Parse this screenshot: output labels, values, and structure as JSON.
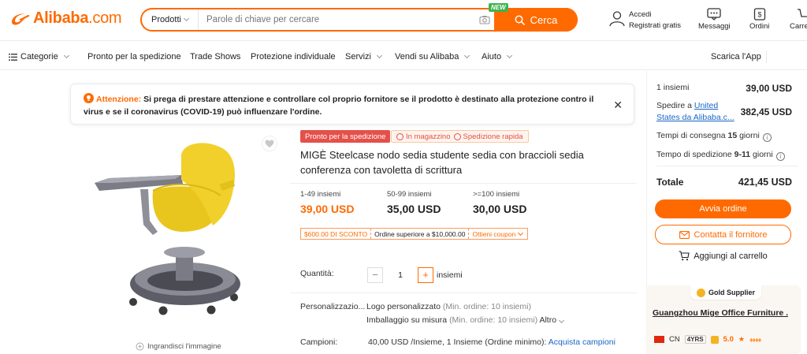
{
  "header": {
    "logo_text": "Alibaba",
    "logo_suffix": ".com",
    "search_category": "Prodotti",
    "search_placeholder": "Parole di chiave per cercare",
    "new_badge": "NEW",
    "search_button": "Cerca",
    "signin_label": "Accedi",
    "register_label": "Registrati gratis",
    "messages_label": "Messaggi",
    "orders_label": "Ordini",
    "cart_label": "Carrello"
  },
  "nav": {
    "categories": "Categorie",
    "items": [
      "Pronto per la spedizione",
      "Trade Shows",
      "Protezione individuale",
      "Servizi",
      "Vendi su Alibaba",
      "Aiuto"
    ],
    "app": "Scarica l'App"
  },
  "alert": {
    "label": "Attenzione:",
    "text": "Si prega di prestare attenzione e controllare col proprio fornitore se il prodotto è destinato alla protezione contro il virus e se il coronavirus (COVID-19) può influenzare l'ordine."
  },
  "product": {
    "tag_ready": "Pronto per la spedizione",
    "tag_stock": "In magazzino",
    "tag_fast": "Spedizione rapida",
    "title": "MIGÈ Steelcase nodo sedia studente sedia con braccioli sedia conferenza con tavoletta di scrittura",
    "zoom_label": "Ingrandisci l'immagine",
    "tiers": [
      {
        "qty": "1-49 insiemi",
        "price": "39,00 USD"
      },
      {
        "qty": "50-99 insiemi",
        "price": "35,00 USD"
      },
      {
        "qty": ">=100 insiemi",
        "price": "30,00 USD"
      }
    ],
    "coupon_discount": "$600.00 DI SCONTO",
    "coupon_condition": "Ordine superiore a $10,000.00",
    "coupon_link": "Ottieni coupon",
    "quantity_label": "Quantità:",
    "quantity_value": "1",
    "quantity_unit": "insiemi",
    "custom_label": "Personalizzazio...",
    "custom_logo": "Logo personalizzato",
    "custom_logo_min": "(Min. ordine: 10 insiemi)",
    "custom_pack": "Imballaggio su misura",
    "custom_pack_min": "(Min. ordine: 10 insiemi)",
    "custom_more": "Altro",
    "samples_label": "Campioni:",
    "samples_value": "40,00 USD /Insieme, 1 Insieme (Ordine minimo):",
    "samples_link": "Acquista campioni"
  },
  "summary": {
    "qty_label": "1 insiemi",
    "qty_price": "39,00 USD",
    "ship_prefix": "Spedire a",
    "ship_dest": "United States da Alibaba.c...",
    "ship_price": "382,45 USD",
    "delivery_label": "Tempi di consegna",
    "delivery_days": "15",
    "delivery_unit": "giorni",
    "dispatch_label": "Tempo di spedizione",
    "dispatch_days": "9-11",
    "dispatch_unit": "giorni",
    "total_label": "Totale",
    "total_price": "421,45 USD",
    "order_button": "Avvia ordine",
    "contact_button": "Contatta il fornitore",
    "cart_button": "Aggiungi al carrello"
  },
  "supplier": {
    "badge": "Gold Supplier",
    "name": "Guangzhou Mige Office Furniture ...",
    "country": "CN",
    "years": "4YRS",
    "rating": "5.0"
  },
  "colors": {
    "accent": "#ff6a00",
    "chair": "#f2d02c",
    "link": "#1966c7"
  }
}
